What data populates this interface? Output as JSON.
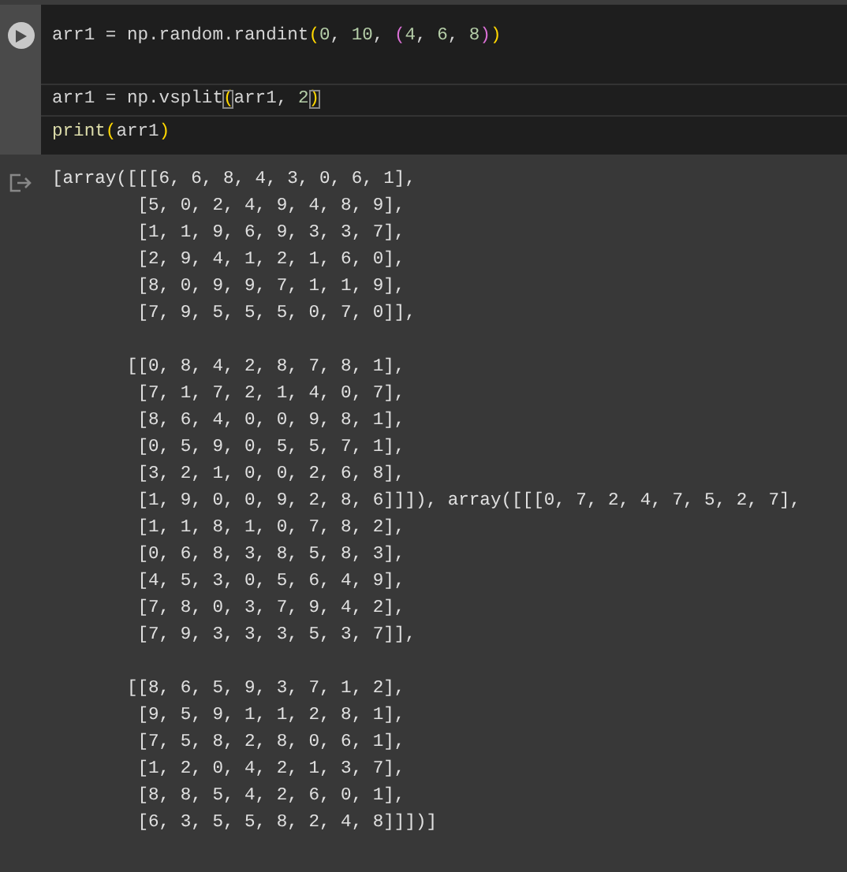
{
  "code_cell": {
    "blocks": [
      [
        {
          "current": false,
          "tokens": [
            {
              "text": "arr1 = np.random.randint",
              "kind": "plain"
            },
            {
              "text": "(",
              "kind": "paren"
            },
            {
              "text": "0",
              "kind": "number"
            },
            {
              "text": ", ",
              "kind": "plain"
            },
            {
              "text": "10",
              "kind": "number"
            },
            {
              "text": ", ",
              "kind": "plain"
            },
            {
              "text": "(",
              "kind": "paren2"
            },
            {
              "text": "4",
              "kind": "number"
            },
            {
              "text": ", ",
              "kind": "plain"
            },
            {
              "text": "6",
              "kind": "number"
            },
            {
              "text": ", ",
              "kind": "plain"
            },
            {
              "text": "8",
              "kind": "number"
            },
            {
              "text": ")",
              "kind": "paren2"
            },
            {
              "text": ")",
              "kind": "paren"
            }
          ]
        }
      ],
      [
        {
          "current": true,
          "tokens": [
            {
              "text": "arr1 = np.vsplit",
              "kind": "plain"
            },
            {
              "text": "(",
              "kind": "paren",
              "matched": true
            },
            {
              "text": "arr1, ",
              "kind": "plain"
            },
            {
              "text": "2",
              "kind": "number"
            },
            {
              "text": ")",
              "kind": "paren",
              "matched": true
            }
          ]
        },
        {
          "current": false,
          "tokens": [
            {
              "text": "print",
              "kind": "func"
            },
            {
              "text": "(",
              "kind": "paren"
            },
            {
              "text": "arr1",
              "kind": "plain"
            },
            {
              "text": ")",
              "kind": "paren"
            }
          ]
        }
      ]
    ]
  },
  "output": {
    "blocks": [
      [
        "[array([[[6, 6, 8, 4, 3, 0, 6, 1],",
        "        [5, 0, 2, 4, 9, 4, 8, 9],",
        "        [1, 1, 9, 6, 9, 3, 3, 7],",
        "        [2, 9, 4, 1, 2, 1, 6, 0],",
        "        [8, 0, 9, 9, 7, 1, 1, 9],",
        "        [7, 9, 5, 5, 5, 0, 7, 0]],"
      ],
      [
        "       [[0, 8, 4, 2, 8, 7, 8, 1],",
        "        [7, 1, 7, 2, 1, 4, 0, 7],",
        "        [8, 6, 4, 0, 0, 9, 8, 1],",
        "        [0, 5, 9, 0, 5, 5, 7, 1],",
        "        [3, 2, 1, 0, 0, 2, 6, 8],",
        "        [1, 9, 0, 0, 9, 2, 8, 6]]]), array([[[0, 7, 2, 4, 7, 5, 2, 7],",
        "        [1, 1, 8, 1, 0, 7, 8, 2],",
        "        [0, 6, 8, 3, 8, 5, 8, 3],",
        "        [4, 5, 3, 0, 5, 6, 4, 9],",
        "        [7, 8, 0, 3, 7, 9, 4, 2],",
        "        [7, 9, 3, 3, 3, 5, 3, 7]],"
      ],
      [
        "       [[8, 6, 5, 9, 3, 7, 1, 2],",
        "        [9, 5, 9, 1, 1, 2, 8, 1],",
        "        [7, 5, 8, 2, 8, 0, 6, 1],",
        "        [1, 2, 0, 4, 2, 1, 3, 7],",
        "        [8, 8, 5, 4, 2, 6, 0, 1],",
        "        [6, 3, 5, 5, 8, 2, 4, 8]]])]"
      ]
    ]
  }
}
